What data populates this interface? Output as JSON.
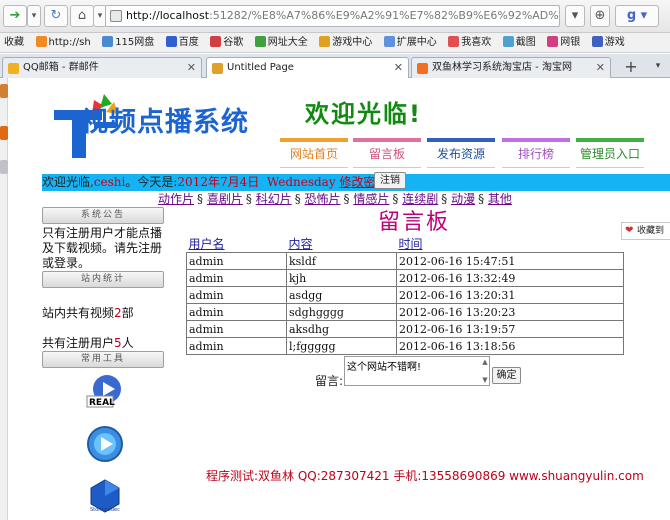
{
  "browser": {
    "url_host": "http://localhost",
    "url_rest": ":51282/%E8%A7%86%E9%A2%91%E7%82%B9%E6%92%AD%E7",
    "bookmarks": [
      "收藏",
      "http://sh",
      "115网盘",
      "百度",
      "谷歌",
      "网址大全",
      "游戏中心",
      "扩展中心",
      "我喜欢",
      "截图",
      "网银",
      "游戏"
    ],
    "tabs": [
      {
        "label": "QQ邮箱 - 群邮件",
        "active": false
      },
      {
        "label": "Untitled Page",
        "active": true
      },
      {
        "label": "双鱼林学习系统淘宝店 - 淘宝网",
        "active": false
      }
    ],
    "new_tab": "+"
  },
  "site": {
    "logo_text": "视频点播系统",
    "welcome": "欢迎光临!",
    "menu": [
      "网站首页",
      "留言板",
      "发布资源",
      "排行榜",
      "管理员入口"
    ],
    "menu_colors": [
      "#f0a030",
      "#e070a0",
      "#3060c0",
      "#c070e0",
      "#40b040"
    ]
  },
  "infobar": {
    "greeting": "欢迎光临,",
    "username": "ceshi",
    "today_label": "。今天是:",
    "date": "2012年7月4日",
    "weekday": "Wednesday",
    "change_pwd": "修改密码",
    "logout": "注销"
  },
  "categories": [
    "动作片",
    "喜剧片",
    "科幻片",
    "恐怖片",
    "情感片",
    "连续剧",
    "动漫",
    "其他"
  ],
  "category_sep": "§",
  "sidebar": {
    "notice_head": "系统公告",
    "notice_text": "只有注册用户才能点播及下载视频。请先注册或登录。",
    "stats_head": "站内统计",
    "video_count_pre": "站内共有视频",
    "video_count": "2",
    "video_count_post": "部",
    "user_count_pre": "共有注册用户",
    "user_count": "5",
    "user_count_post": "人",
    "tools_head": "常用工具",
    "tools": [
      "real-player-icon",
      "media-player-icon",
      "stormcodec-icon"
    ],
    "tool_caption": "REAL",
    "storm_caption": "Stormcodec"
  },
  "board": {
    "title": "留言板",
    "columns": [
      "用户名",
      "内容",
      "时间"
    ],
    "rows": [
      [
        "admin",
        "ksldf",
        "2012-06-16 15:47:51"
      ],
      [
        "admin",
        "kjh",
        "2012-06-16 13:32:49"
      ],
      [
        "admin",
        "asdgg",
        "2012-06-16 13:20:31"
      ],
      [
        "admin",
        "sdghgggg",
        "2012-06-16 13:20:23"
      ],
      [
        "admin",
        "aksdhg",
        "2012-06-16 13:19:57"
      ],
      [
        "admin",
        "l;fggggg",
        "2012-06-16 13:18:56"
      ]
    ],
    "message_label": "留言:",
    "message_value": "这个网站不错啊!",
    "confirm": "确定"
  },
  "footer": "程序测试:双鱼林 QQ:287307421 手机:13558690869 www.shuangyulin.com",
  "fav_tab": "收藏到"
}
